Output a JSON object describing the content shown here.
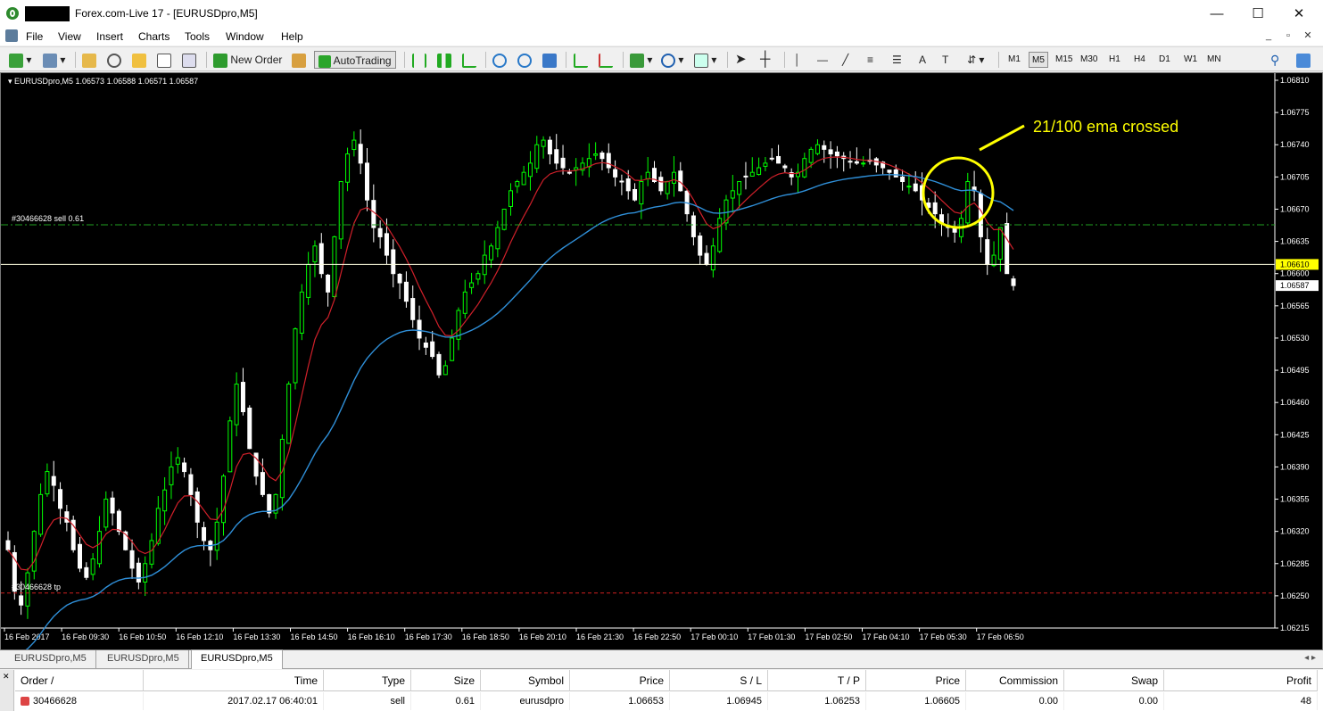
{
  "window": {
    "title": "Forex.com-Live 17 - [EURUSDpro,M5]",
    "minimize": "—",
    "maximize": "☐",
    "close": "✕"
  },
  "menu": [
    "File",
    "View",
    "Insert",
    "Charts",
    "Tools",
    "Window",
    "Help"
  ],
  "toolbar": {
    "new_order": "New Order",
    "autotrading": "AutoTrading",
    "timeframes": [
      "M1",
      "M5",
      "M15",
      "M30",
      "H1",
      "H4",
      "D1",
      "W1",
      "MN"
    ],
    "active_timeframe": "M5"
  },
  "chart": {
    "header": "EURUSDpro,M5  1.06573 1.06588 1.06571 1.06587",
    "annotation": "21/100 ema crossed",
    "order_label": "#30466628 sell 0.61",
    "tp_label": "#30466628 tp",
    "bid_price": "1.06610",
    "ask_price": "1.06587",
    "colors": {
      "background": "#000000",
      "bull_candle": "#00ff00",
      "bear_candle": "#ffffff",
      "ema21": "#d0202a",
      "ema100": "#2f8fd8",
      "order_line": "#1fa11f",
      "tp_line": "#d02020",
      "annotation": "#ffff00"
    }
  },
  "chart_data": {
    "type": "candlestick",
    "symbol": "EURUSDpro",
    "timeframe": "M5",
    "ylim": [
      1.06215,
      1.0681
    ],
    "y_ticks": [
      "1.06810",
      "1.06775",
      "1.06740",
      "1.06705",
      "1.06670",
      "1.06635",
      "1.06600",
      "1.06565",
      "1.06530",
      "1.06495",
      "1.06460",
      "1.06425",
      "1.06390",
      "1.06355",
      "1.06320",
      "1.06285",
      "1.06250",
      "1.06215"
    ],
    "x_ticks": [
      "16 Feb 2017",
      "16 Feb 09:30",
      "16 Feb 10:50",
      "16 Feb 12:10",
      "16 Feb 13:30",
      "16 Feb 14:50",
      "16 Feb 16:10",
      "16 Feb 17:30",
      "16 Feb 18:50",
      "16 Feb 20:10",
      "16 Feb 21:30",
      "16 Feb 22:50",
      "17 Feb 00:10",
      "17 Feb 01:30",
      "17 Feb 02:50",
      "17 Feb 04:10",
      "17 Feb 05:30",
      "17 Feb 06:50"
    ],
    "price_lines": {
      "order_sell": 1.06653,
      "take_profit": 1.06253,
      "bid": 1.0661,
      "ask": 1.06587
    },
    "close_series": [
      1.063,
      1.06255,
      1.0624,
      1.06275,
      1.0632,
      1.0636,
      1.06385,
      1.0637,
      1.06345,
      1.0633,
      1.063,
      1.0628,
      1.0627,
      1.0629,
      1.0632,
      1.06355,
      1.0634,
      1.0632,
      1.063,
      1.0628,
      1.06265,
      1.06285,
      1.0631,
      1.06345,
      1.06365,
      1.0639,
      1.064,
      1.06385,
      1.0636,
      1.0633,
      1.0631,
      1.063,
      1.0633,
      1.0638,
      1.0644,
      1.0648,
      1.0645,
      1.0641,
      1.0638,
      1.0636,
      1.0634,
      1.0636,
      1.0642,
      1.0648,
      1.0654,
      1.0658,
      1.0661,
      1.0663,
      1.066,
      1.0658,
      1.0664,
      1.067,
      1.0673,
      1.06745,
      1.0672,
      1.0668,
      1.0665,
      1.0664,
      1.0662,
      1.066,
      1.0659,
      1.0657,
      1.0655,
      1.0653,
      1.0652,
      1.0651,
      1.0649,
      1.065,
      1.0653,
      1.0656,
      1.0658,
      1.0659,
      1.066,
      1.0662,
      1.0663,
      1.0665,
      1.0667,
      1.0669,
      1.067,
      1.0671,
      1.0672,
      1.0674,
      1.06745,
      1.0673,
      1.0672,
      1.06715,
      1.0671,
      1.06715,
      1.0672,
      1.06725,
      1.0673,
      1.06725,
      1.06715,
      1.06705,
      1.067,
      1.0669,
      1.0668,
      1.067,
      1.0671,
      1.067,
      1.0669,
      1.067,
      1.0671,
      1.0669,
      1.06665,
      1.0664,
      1.0662,
      1.0661,
      1.0663,
      1.0666,
      1.0668,
      1.0669,
      1.067,
      1.06705,
      1.0671,
      1.06715,
      1.0672,
      1.06725,
      1.0672,
      1.06715,
      1.06705,
      1.0671,
      1.06725,
      1.06735,
      1.0674,
      1.06735,
      1.0673,
      1.06728,
      1.06725,
      1.06722,
      1.0672,
      1.0672,
      1.06722,
      1.06718,
      1.06715,
      1.0671,
      1.06705,
      1.067,
      1.06695,
      1.0669,
      1.0668,
      1.06672,
      1.06665,
      1.06655,
      1.0665,
      1.06645,
      1.0666,
      1.067,
      1.0669,
      1.0664,
      1.0661,
      1.0662,
      1.0665,
      1.066,
      1.06587
    ],
    "candle_count": 150,
    "series": [
      {
        "name": "EMA 21"
      },
      {
        "name": "EMA 100"
      }
    ]
  },
  "tabs": [
    "EURUSDpro,M5",
    "EURUSDpro,M5",
    "EURUSDpro,M5"
  ],
  "active_tab_index": 2,
  "orders_table": {
    "headers": [
      "Order",
      "Time",
      "Type",
      "Size",
      "Symbol",
      "Price",
      "S / L",
      "T / P",
      "Price",
      "Commission",
      "Swap",
      "Profit"
    ],
    "rows": [
      [
        "30466628",
        "2017.02.17 06:40:01",
        "sell",
        "0.61",
        "eurusdpro",
        "1.06653",
        "1.06945",
        "1.06253",
        "1.06605",
        "0.00",
        "0.00",
        "48"
      ]
    ]
  }
}
